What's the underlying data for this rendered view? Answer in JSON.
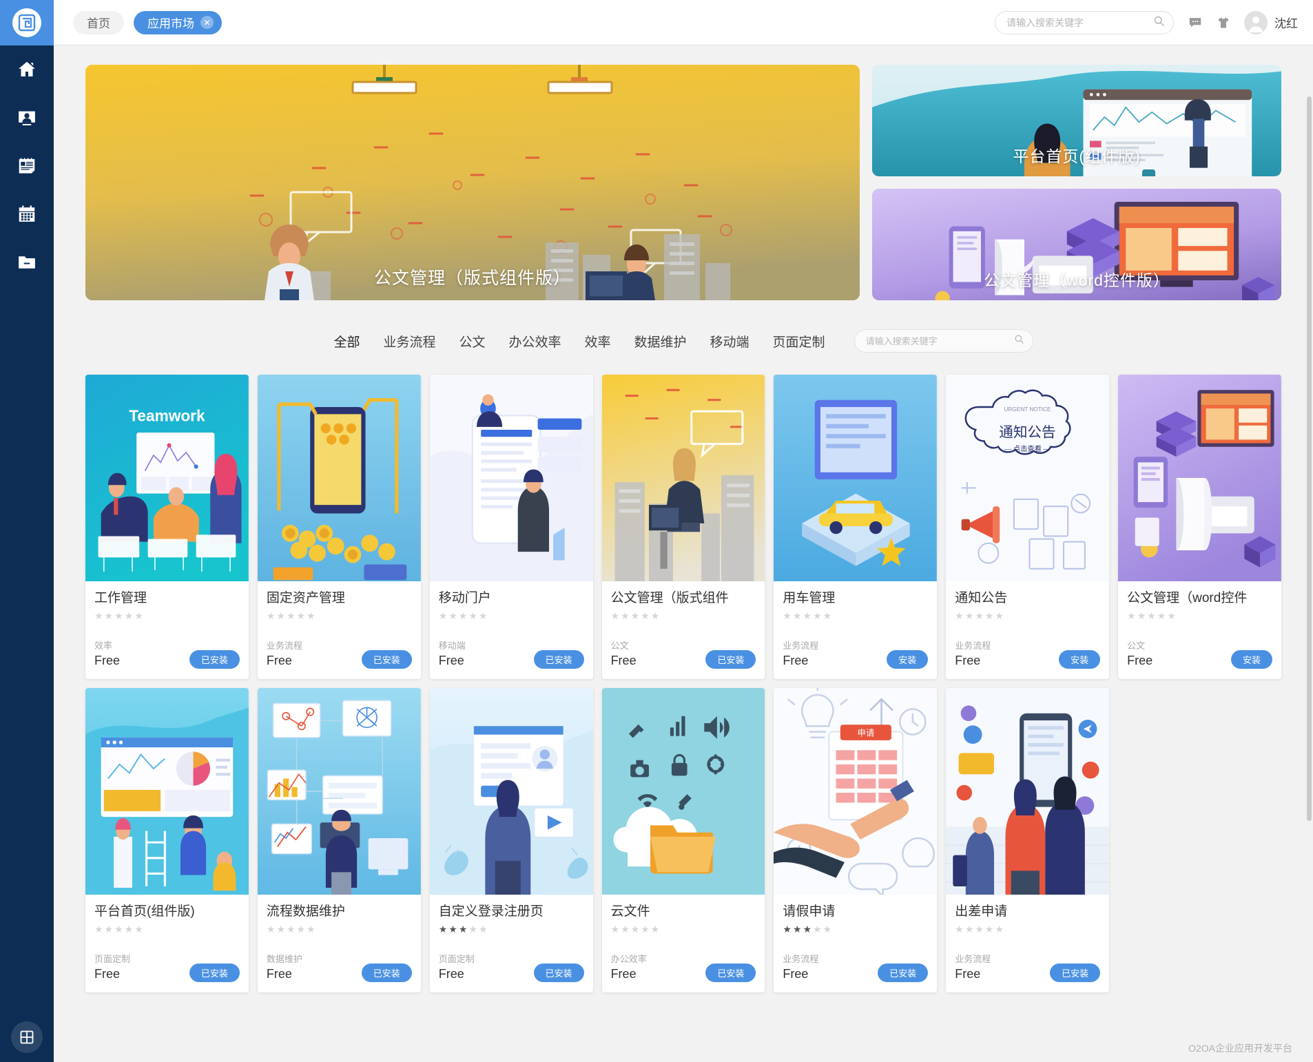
{
  "sidebar": {
    "logo_icon": "o2oa-logo-icon",
    "items": [
      {
        "icon": "home-icon",
        "name": "sidebar-item-home"
      },
      {
        "icon": "meeting-icon",
        "name": "sidebar-item-meeting"
      },
      {
        "icon": "news-icon",
        "name": "sidebar-item-news"
      },
      {
        "icon": "calendar-icon",
        "name": "sidebar-item-calendar"
      },
      {
        "icon": "folder-icon",
        "name": "sidebar-item-files"
      }
    ],
    "bottom_icon": "apps-grid-icon"
  },
  "topbar": {
    "breadcrumbs": [
      {
        "label": "首页",
        "active": false,
        "closable": false
      },
      {
        "label": "应用市场",
        "active": true,
        "closable": true
      }
    ],
    "close_glyph": "✕",
    "search": {
      "placeholder": "请输入搜索关键字",
      "value": "",
      "icon": "search-icon"
    },
    "icons": [
      {
        "name": "message-icon",
        "glyph": "message"
      },
      {
        "name": "shirt-icon",
        "glyph": "shirt"
      }
    ],
    "user": {
      "name": "沈红",
      "avatar_icon": "avatar-icon"
    }
  },
  "hero": {
    "main": {
      "title": "公文管理（版式组件版）"
    },
    "side": [
      {
        "title": "平台首页(组件版)"
      },
      {
        "title": "公文管理（word控件版）"
      }
    ]
  },
  "categories": {
    "items": [
      {
        "label": "全部",
        "active": true
      },
      {
        "label": "业务流程",
        "active": false
      },
      {
        "label": "公文",
        "active": false
      },
      {
        "label": "办公效率",
        "active": false
      },
      {
        "label": "效率",
        "active": false
      },
      {
        "label": "数据维护",
        "active": false
      },
      {
        "label": "移动端",
        "active": false
      },
      {
        "label": "页面定制",
        "active": false
      }
    ],
    "search": {
      "placeholder": "请输入搜索关键字",
      "value": "",
      "icon": "search-icon"
    }
  },
  "apps": [
    {
      "name": "工作管理",
      "rating": 0,
      "category": "效率",
      "price": "Free",
      "button": "已安装",
      "thumb": "teamwork"
    },
    {
      "name": "固定资产管理",
      "rating": 0,
      "category": "业务流程",
      "price": "Free",
      "button": "已安装",
      "thumb": "assets"
    },
    {
      "name": "移动门户",
      "rating": 0,
      "category": "移动端",
      "price": "Free",
      "button": "已安装",
      "thumb": "mobile"
    },
    {
      "name": "公文管理（版式组件",
      "rating": 0,
      "category": "公文",
      "price": "Free",
      "button": "已安装",
      "thumb": "doc-yellow"
    },
    {
      "name": "用车管理",
      "rating": 0,
      "category": "业务流程",
      "price": "Free",
      "button": "安装",
      "thumb": "car"
    },
    {
      "name": "通知公告",
      "rating": 0,
      "category": "业务流程",
      "price": "Free",
      "button": "安装",
      "thumb": "notice"
    },
    {
      "name": "公文管理（word控件",
      "rating": 0,
      "category": "公文",
      "price": "Free",
      "button": "安装",
      "thumb": "doc-purple"
    },
    {
      "name": "平台首页(组件版)",
      "rating": 0,
      "category": "页面定制",
      "price": "Free",
      "button": "已安装",
      "thumb": "portal"
    },
    {
      "name": "流程数据维护",
      "rating": 0,
      "category": "数据维护",
      "price": "Free",
      "button": "已安装",
      "thumb": "data"
    },
    {
      "name": "自定义登录注册页",
      "rating": 3,
      "category": "页面定制",
      "price": "Free",
      "button": "已安装",
      "thumb": "login"
    },
    {
      "name": "云文件",
      "rating": 0,
      "category": "办公效率",
      "price": "Free",
      "button": "已安装",
      "thumb": "cloud"
    },
    {
      "name": "请假申请",
      "rating": 3,
      "category": "业务流程",
      "price": "Free",
      "button": "已安装",
      "thumb": "leave"
    },
    {
      "name": "出差申请",
      "rating": 0,
      "category": "业务流程",
      "price": "Free",
      "button": "已安装",
      "thumb": "travel"
    }
  ],
  "footer": {
    "text": "O2OA企业应用开发平台"
  },
  "colors": {
    "accent": "#4a90e2",
    "sidebar": "#0d2d55",
    "page_bg": "#f2f2f2",
    "star_filled": "#555555",
    "star_empty": "#d6d6d6"
  }
}
